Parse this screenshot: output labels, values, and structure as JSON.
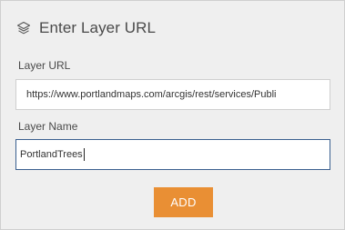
{
  "header": {
    "title": "Enter Layer URL",
    "icon": "layers-icon"
  },
  "form": {
    "url_label": "Layer URL",
    "url_value": "https://www.portlandmaps.com/arcgis/rest/services/Publi",
    "name_label": "Layer Name",
    "name_value": "PortlandTrees",
    "add_label": "ADD"
  },
  "colors": {
    "background": "#efefef",
    "button": "#e98f34",
    "focus_border": "#3a5f8f"
  }
}
